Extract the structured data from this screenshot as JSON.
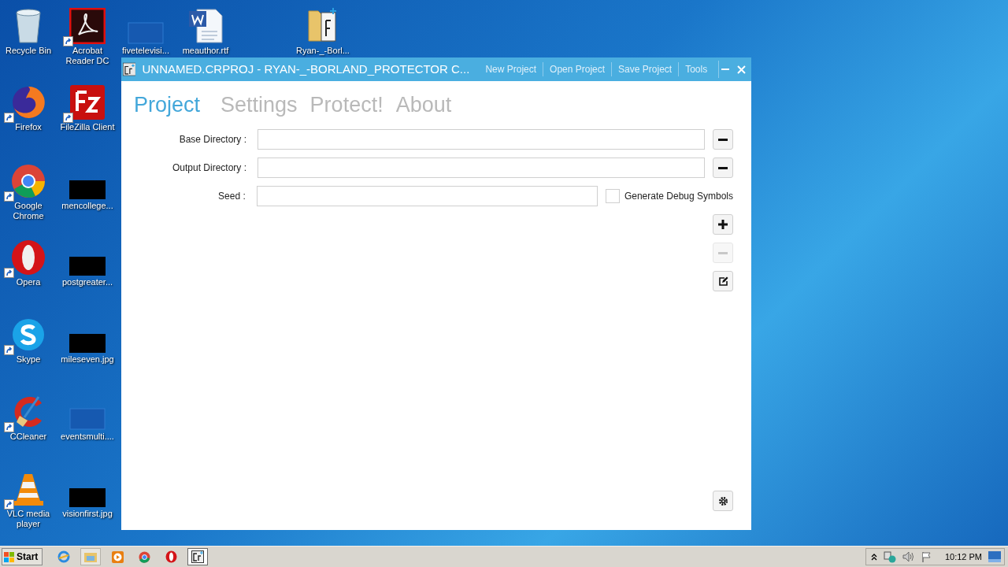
{
  "desktop_icons": [
    {
      "label": "Recycle Bin",
      "kind": "trash",
      "shortcut": false
    },
    {
      "label": "Acrobat Reader DC",
      "kind": "acrobat",
      "shortcut": true
    },
    {
      "label": "fivetelevisi...",
      "kind": "blank",
      "shortcut": false
    },
    {
      "label": "meauthor.rtf",
      "kind": "word",
      "shortcut": false
    },
    {
      "label": "Ryan-_-Borl...",
      "kind": "folder",
      "shortcut": false
    },
    {
      "label": "Firefox",
      "kind": "firefox",
      "shortcut": true
    },
    {
      "label": "FileZilla Client",
      "kind": "filezilla",
      "shortcut": true
    },
    {
      "label": "Google Chrome",
      "kind": "chrome",
      "shortcut": true
    },
    {
      "label": "mencollege...",
      "kind": "black",
      "shortcut": false
    },
    {
      "label": "Opera",
      "kind": "opera",
      "shortcut": true
    },
    {
      "label": "postgreater...",
      "kind": "black",
      "shortcut": false
    },
    {
      "label": "Skype",
      "kind": "skype",
      "shortcut": true
    },
    {
      "label": "mileseven.jpg",
      "kind": "black",
      "shortcut": false
    },
    {
      "label": "CCleaner",
      "kind": "ccleaner",
      "shortcut": true
    },
    {
      "label": "eventsmulti....",
      "kind": "blank",
      "shortcut": false
    },
    {
      "label": "VLC media player",
      "kind": "vlc",
      "shortcut": true
    },
    {
      "label": "visionfirst.jpg",
      "kind": "black",
      "shortcut": false
    }
  ],
  "window": {
    "title": "UNNAMED.CRPROJ - RYAN-_-BORLAND_PROTECTOR C...",
    "menu": [
      "New Project",
      "Open Project",
      "Save Project",
      "Tools"
    ],
    "tabs": [
      {
        "label": "Project",
        "selected": true
      },
      {
        "label": "Settings",
        "selected": false
      },
      {
        "label": "Protect!",
        "selected": false
      },
      {
        "label": "About",
        "selected": false
      }
    ],
    "fields": [
      {
        "label": "Base Directory :",
        "kind": "browse"
      },
      {
        "label": "Output Directory :",
        "kind": "browse"
      },
      {
        "label": "Seed :",
        "kind": "seed"
      }
    ],
    "debug_checkbox": {
      "label": "Generate Debug Symbols",
      "checked": false
    },
    "side_buttons": [
      {
        "kind": "add",
        "disabled": false
      },
      {
        "kind": "remove",
        "disabled": true
      },
      {
        "kind": "edit",
        "disabled": false
      }
    ]
  },
  "taskbar": {
    "start": "Start",
    "items": [
      {
        "kind": "ie",
        "selected": false
      },
      {
        "kind": "explorer",
        "selected": false
      },
      {
        "kind": "media",
        "selected": false
      },
      {
        "kind": "chrome",
        "selected": false
      },
      {
        "kind": "opera",
        "selected": false
      },
      {
        "kind": "app",
        "selected": true
      }
    ],
    "clock": "10:12 PM"
  }
}
